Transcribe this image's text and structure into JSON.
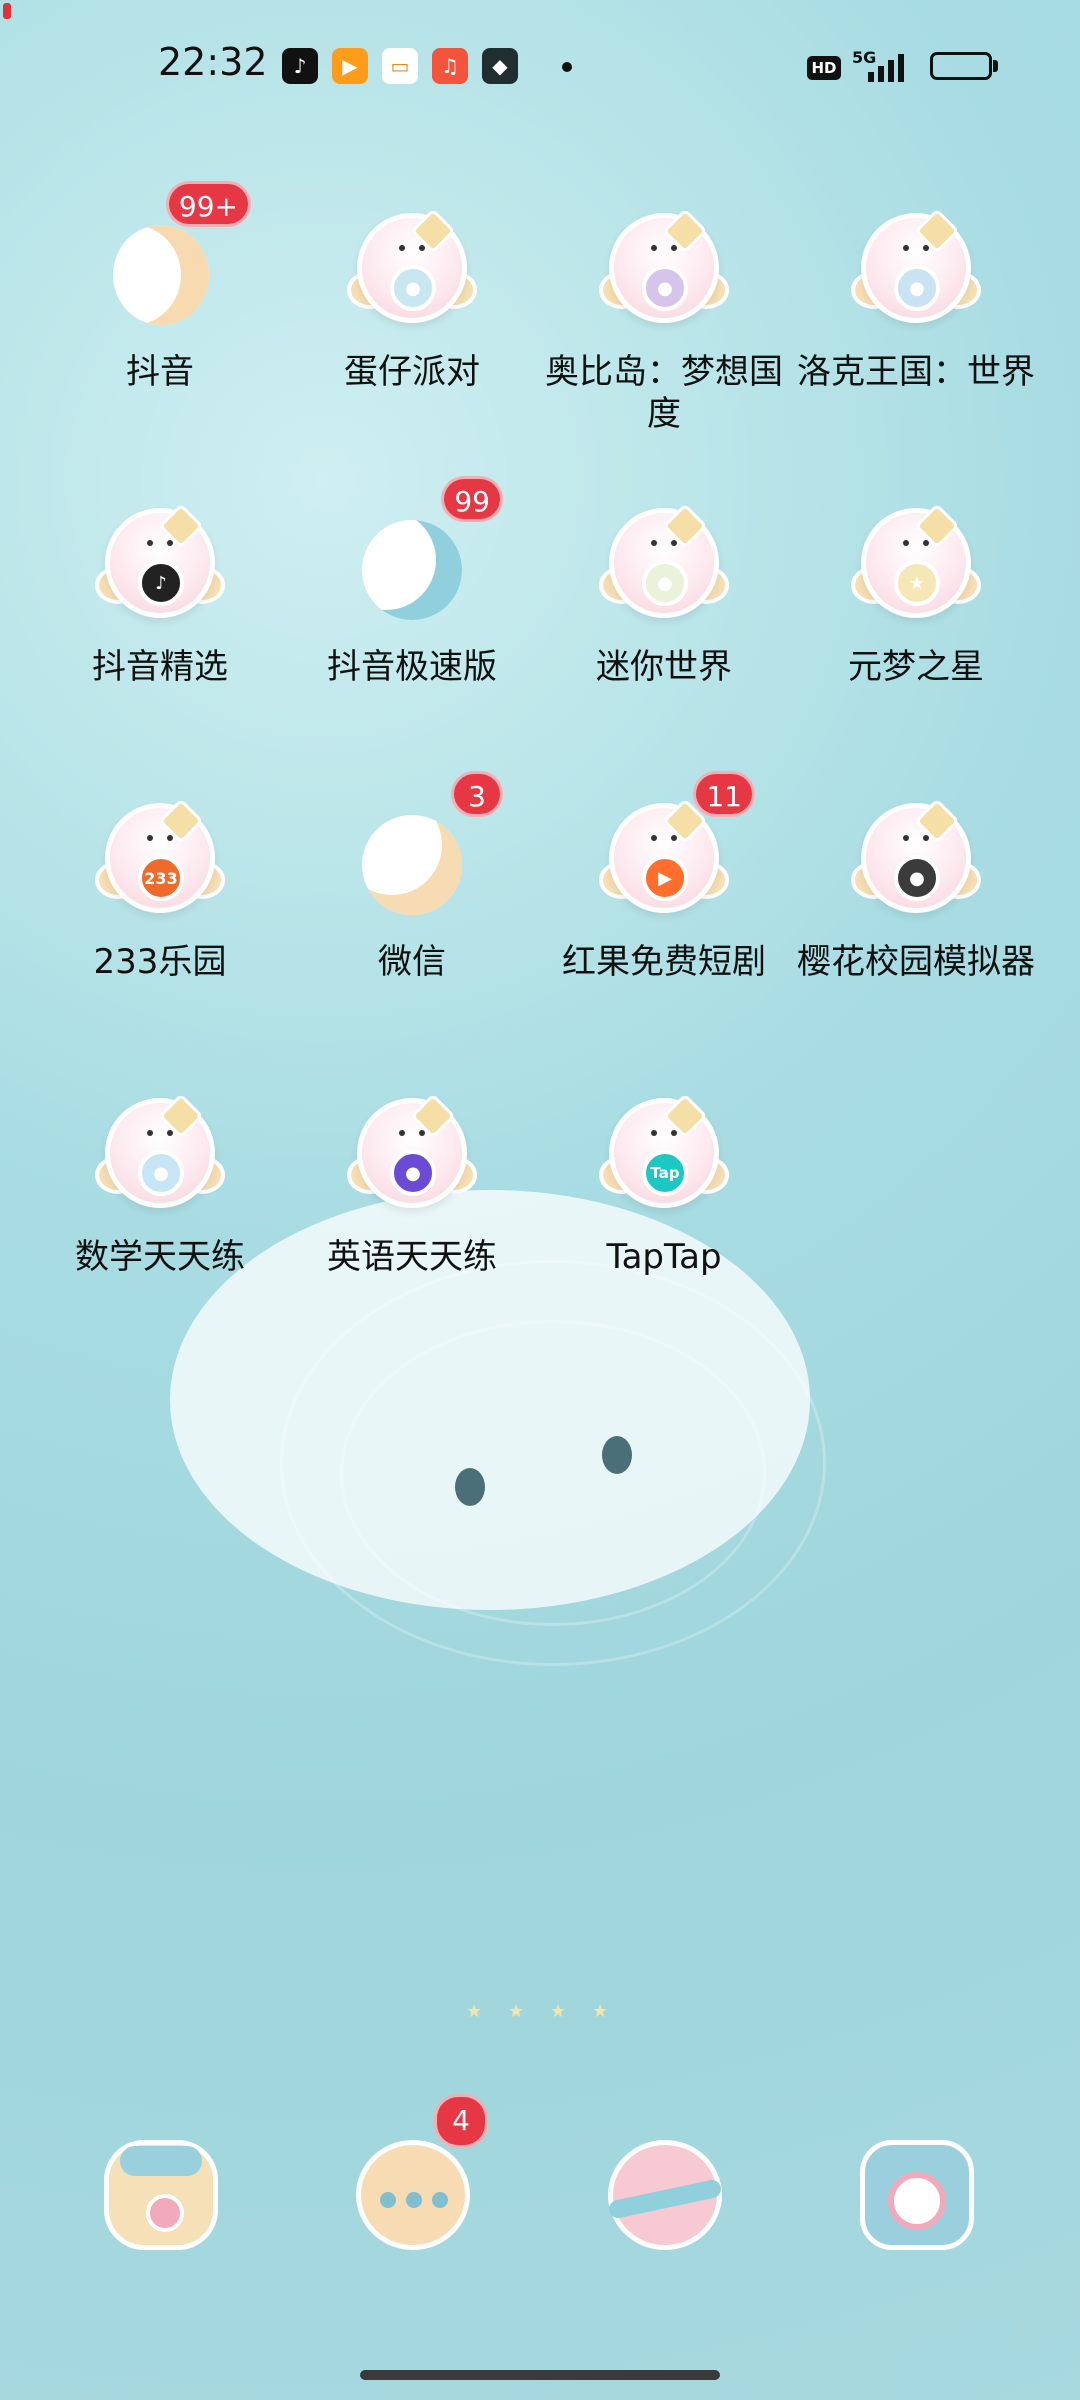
{
  "status_bar": {
    "time": "22:32",
    "hd_label": "HD",
    "network_label": "5G",
    "notification_icons": [
      {
        "name": "douyin-notif-icon",
        "color": "#111111",
        "glyph": "♪"
      },
      {
        "name": "video-notif-icon",
        "color": "#ff9c1a",
        "glyph": "▶"
      },
      {
        "name": "wallet-notif-icon",
        "color": "#ffffff",
        "glyph": "▭"
      },
      {
        "name": "music-notif-icon",
        "color": "#f2543c",
        "glyph": "♫"
      },
      {
        "name": "game-notif-icon",
        "color": "#1f2f2f",
        "glyph": "◆"
      }
    ],
    "battery_level": 0.15,
    "battery_color": "#e0303a"
  },
  "apps": [
    {
      "label": "抖音",
      "badge": "99+"
    },
    {
      "label": "蛋仔派对",
      "badge": ""
    },
    {
      "label": "奥比岛：梦想国度",
      "badge": ""
    },
    {
      "label": "洛克王国：世界",
      "badge": ""
    },
    {
      "label": "抖音精选",
      "badge": ""
    },
    {
      "label": "抖音极速版",
      "badge": "99"
    },
    {
      "label": "迷你世界",
      "badge": ""
    },
    {
      "label": "元梦之星",
      "badge": ""
    },
    {
      "label": "233乐园",
      "badge": ""
    },
    {
      "label": "微信",
      "badge": "3"
    },
    {
      "label": "红果免费短剧",
      "badge": "11"
    },
    {
      "label": "樱花校园模拟器",
      "badge": ""
    },
    {
      "label": "数学天天练",
      "badge": ""
    },
    {
      "label": "英语天天练",
      "badge": ""
    },
    {
      "label": "TapTap",
      "badge": ""
    }
  ],
  "inner_icon_text": {
    "233": "233",
    "taptap": "Tap"
  },
  "dock": [
    {
      "name": "dock-phone",
      "badge": ""
    },
    {
      "name": "dock-messages",
      "badge": "4"
    },
    {
      "name": "dock-browser",
      "badge": ""
    },
    {
      "name": "dock-camera",
      "badge": ""
    }
  ],
  "colors": {
    "badge": "#e63745",
    "background": "#a9dde3"
  }
}
